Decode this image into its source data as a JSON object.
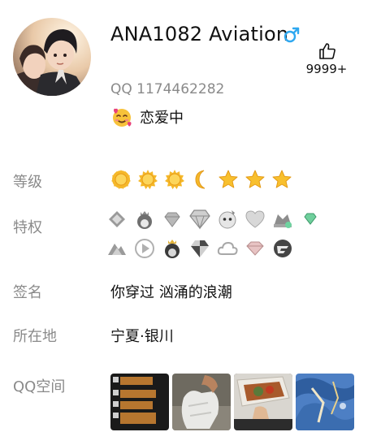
{
  "profile": {
    "name": "ANA1082 Aviation",
    "gender_icon": "male-icon",
    "qq_number": "QQ 1174462282",
    "likes": "9999+",
    "status_emoji": "smiling-face-with-hearts-icon",
    "status_text": "恋爱中"
  },
  "rows": {
    "level_label": "等级",
    "privilege_label": "特权",
    "signature_label": "签名",
    "signature_value": "你穿过 汹涌的浪潮",
    "location_label": "所在地",
    "location_value": "宁夏·银川",
    "qzone_label": "QQ空间"
  },
  "levels": [
    "sun-icon",
    "sun-icon",
    "sun-icon",
    "moon-icon",
    "star-icon",
    "star-icon",
    "star-icon"
  ],
  "privileges": [
    "svip-badge-icon",
    "crown-penguin-icon",
    "diamond-icon",
    "big-diamond-icon",
    "penguin-face-icon",
    "heart-icon",
    "crown-badge-icon",
    "green-gem-icon",
    "mountain-badge-icon",
    "play-icon",
    "king-penguin-icon",
    "black-diamond-icon",
    "cloud-icon",
    "pink-diamond-icon",
    "speed-badge-icon"
  ],
  "photos": [
    "chat-screenshot-photo",
    "bag-photo",
    "food-photo",
    "blue-abstract-photo"
  ],
  "colors": {
    "label_gray": "#8a8a8a",
    "male_blue": "#2fa8f0",
    "gold": "#f5b82a"
  }
}
